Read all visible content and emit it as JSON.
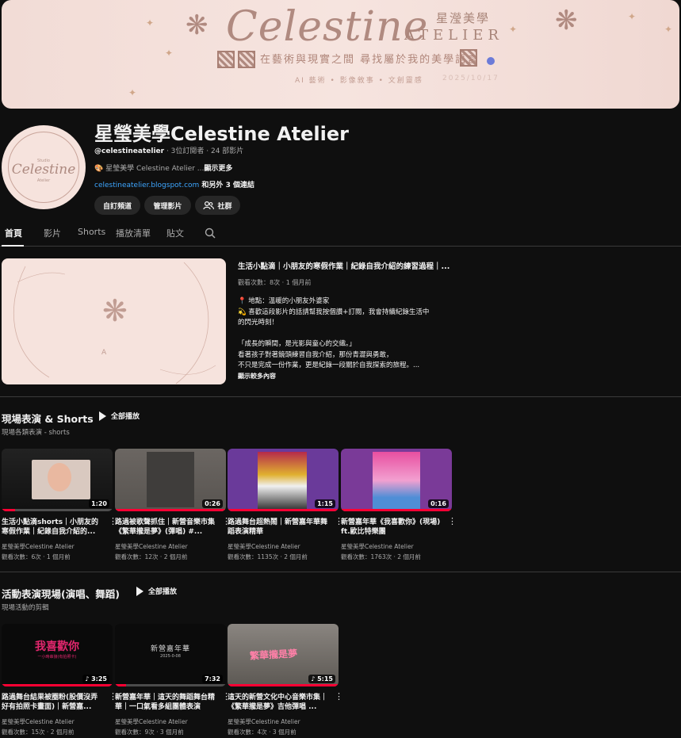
{
  "banner": {
    "brand": "Celestine",
    "atelier": "ATELIER",
    "cn_name": "星瀅美學",
    "tagline": "在藝術與現實之間 尋找屬於我的美學語言",
    "subline": "AI 藝術 • 影像敘事 • 文創靈感",
    "date": "2025/10/17"
  },
  "channel": {
    "title": "星瑩美學Celestine Atelier",
    "handle": "@celestineatelier",
    "stats": " · 3位訂閱者 · 24 部影片",
    "description": "星瑩美學 Celestine Atelier ...",
    "show_more": "顯示更多",
    "link": "celestineatelier.blogspot.com",
    "also_links": " 和另外 3 個連結",
    "buttons": {
      "customize": "自訂頻道",
      "manage": "管理影片",
      "community": "社群"
    },
    "avatar": {
      "top": "Studio",
      "name": "Celestine",
      "bottom": "Atelier"
    }
  },
  "tabs": {
    "home": "首頁",
    "videos": "影片",
    "shorts": "Shorts",
    "playlists": "播放清單",
    "posts": "貼文"
  },
  "featured": {
    "title": "生活小點滴｜小朋友的寒假作業｜紀錄自我介紹的練習過程｜...",
    "meta": "觀看次數：8次 · 1 個月前",
    "desc_lines": [
      "📍 地點：溫暖的小朋友外婆家",
      "💫 喜歡這段影片的話請幫我按個讚+訂閱，我會持續紀錄生活中",
      "的閃光時刻！",
      "",
      "「成長的瞬間，是光影與童心的交織。」",
      "看著孩子對著鏡頭練習自我介紹，那份青澀與勇敢，",
      "不只是完成一份作業，更是紀錄一段關於自我探索的旅程。..."
    ],
    "more": "顯示較多內容",
    "thumb_letter": "A"
  },
  "section1": {
    "title": "現場表演 & Shorts",
    "play_all": "全部播放",
    "subtitle": "現場各類表演 - shorts",
    "videos": [
      {
        "title": "生活小點滴shorts｜小朋友的寒假作業｜紀錄自我介紹的...",
        "channel": "星瑩美學Celestine Atelier",
        "meta": "觀看次數：6次 · 1 個月前",
        "duration": "1:20",
        "progress": 0.12
      },
      {
        "title": "路過被歌聲抓住｜新營音樂市集《繁華攏是夢》(彈唱) #...",
        "channel": "星瑩美學Celestine Atelier",
        "meta": "觀看次數：12次 · 2 個月前",
        "duration": "0:26",
        "progress": 1.0
      },
      {
        "title": "路過舞台超熱鬧｜新營嘉年華舞蹈表演精華",
        "channel": "星瑩美學Celestine Atelier",
        "meta": "觀看次數：1135次 · 2 個月前",
        "duration": "1:15",
        "progress": 1.0
      },
      {
        "title": "新營嘉年華《我喜歡你》(現場) ft.歐比特樂團",
        "channel": "星瑩美學Celestine Atelier",
        "meta": "觀看次數：1763次 · 2 個月前",
        "duration": "0:16",
        "progress": 1.0
      }
    ]
  },
  "section2": {
    "title": "活動表演現場(演唱、舞蹈)",
    "play_all": "全部播放",
    "subtitle": "現場活動的剪輯",
    "videos": [
      {
        "title": "路過舞台結果被圈粉(股價沒弄好有拍照卡畫面)｜新營嘉...",
        "channel": "星瑩美學Celestine Atelier",
        "meta": "觀看次數：15次 · 2 個月前",
        "duration": "3:25",
        "progress": 1.0,
        "thumb_text": "我喜歡你",
        "thumb_sub": "一小時串接(有拍照卡)"
      },
      {
        "title": "新營嘉年華｜這天的舞蹈舞台精華｜一口氣看多組團體表演",
        "channel": "星瑩美學Celestine Atelier",
        "meta": "觀看次數：9次 · 3 個月前",
        "duration": "7:32",
        "progress": 0.1,
        "thumb_text": "新營嘉年華",
        "thumb_sub": "2025-0-08"
      },
      {
        "title": "這天的新營文化中心音樂市集｜《繁華攏是夢》吉他彈唱 ...",
        "channel": "星瑩美學Celestine Atelier",
        "meta": "觀看次數：4次 · 3 個月前",
        "duration": "5:15",
        "progress": 1.0,
        "thumb_text": "繁華攏是夢"
      }
    ]
  }
}
